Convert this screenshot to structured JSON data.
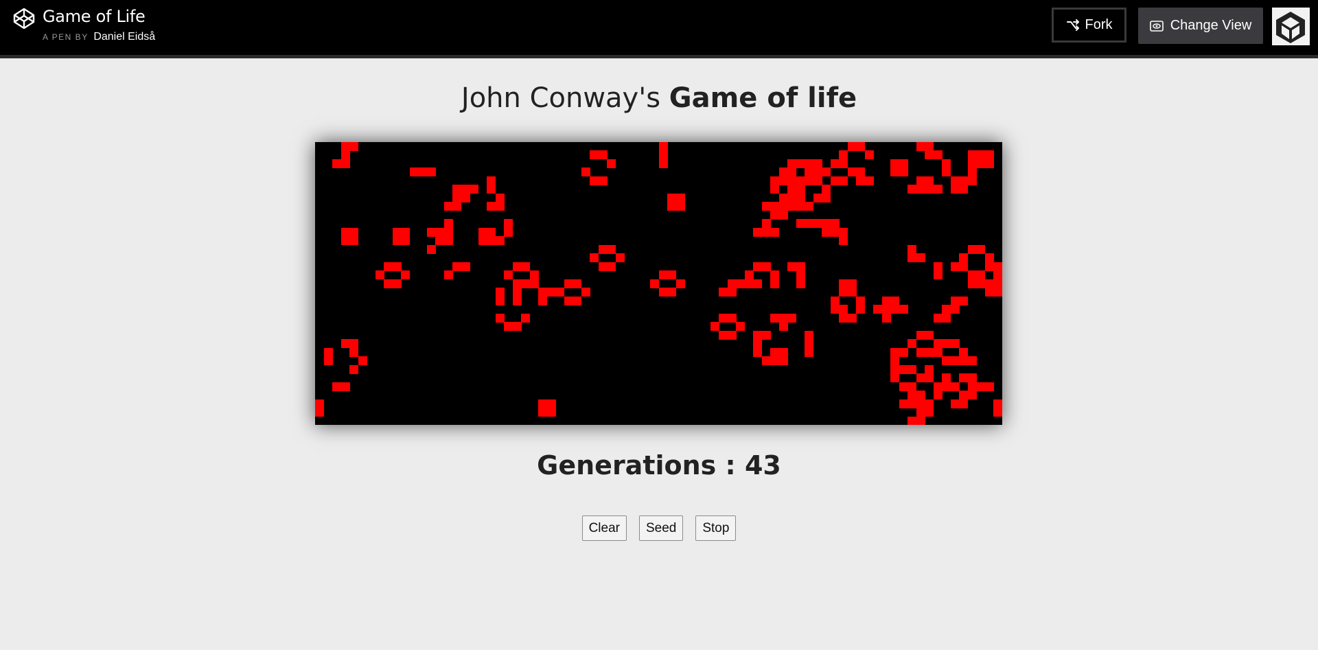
{
  "header": {
    "pen_title": "Game of Life",
    "byline_prefix": "A PEN BY",
    "author": "Daniel Eidså",
    "fork_label": "Fork",
    "change_view_label": "Change View",
    "icons": {
      "logo": "codepen-logo-icon",
      "fork": "fork-icon",
      "view": "eye-icon",
      "avatar": "user-avatar"
    }
  },
  "main": {
    "title_prefix": "John Conway's ",
    "title_bold": "Game of life",
    "generations_text": "Generations : 43",
    "buttons": {
      "clear": "Clear",
      "seed": "Seed",
      "stop": "Stop"
    }
  },
  "board": {
    "columns": 80,
    "rows": 33,
    "alive_color": "#ff0000",
    "dead_color": "#000000",
    "alive_cells": [
      [
        3,
        0
      ],
      [
        4,
        0
      ],
      [
        3,
        1
      ],
      [
        2,
        2
      ],
      [
        3,
        2
      ],
      [
        0,
        30
      ],
      [
        0,
        31
      ],
      [
        11,
        3
      ],
      [
        12,
        3
      ],
      [
        13,
        3
      ],
      [
        16,
        5
      ],
      [
        17,
        5
      ],
      [
        18,
        5
      ],
      [
        16,
        6
      ],
      [
        17,
        6
      ],
      [
        15,
        7
      ],
      [
        16,
        7
      ],
      [
        20,
        4
      ],
      [
        20,
        5
      ],
      [
        21,
        6
      ],
      [
        20,
        7
      ],
      [
        21,
        7
      ],
      [
        3,
        10
      ],
      [
        4,
        10
      ],
      [
        3,
        11
      ],
      [
        4,
        11
      ],
      [
        9,
        10
      ],
      [
        10,
        10
      ],
      [
        9,
        11
      ],
      [
        10,
        11
      ],
      [
        13,
        10
      ],
      [
        14,
        10
      ],
      [
        15,
        10
      ],
      [
        15,
        9
      ],
      [
        14,
        11
      ],
      [
        15,
        11
      ],
      [
        13,
        12
      ],
      [
        19,
        10
      ],
      [
        20,
        10
      ],
      [
        19,
        11
      ],
      [
        20,
        11
      ],
      [
        22,
        9
      ],
      [
        22,
        10
      ],
      [
        21,
        11
      ],
      [
        16,
        14
      ],
      [
        17,
        14
      ],
      [
        15,
        15
      ],
      [
        8,
        14
      ],
      [
        9,
        14
      ],
      [
        7,
        15
      ],
      [
        10,
        15
      ],
      [
        8,
        16
      ],
      [
        9,
        16
      ],
      [
        23,
        14
      ],
      [
        24,
        14
      ],
      [
        22,
        15
      ],
      [
        25,
        15
      ],
      [
        23,
        16
      ],
      [
        24,
        16
      ],
      [
        25,
        16
      ],
      [
        21,
        17
      ],
      [
        21,
        18
      ],
      [
        23,
        17
      ],
      [
        24,
        16
      ],
      [
        23,
        18
      ],
      [
        21,
        20
      ],
      [
        22,
        21
      ],
      [
        23,
        21
      ],
      [
        24,
        20
      ],
      [
        26,
        17
      ],
      [
        27,
        17
      ],
      [
        29,
        16
      ],
      [
        30,
        16
      ],
      [
        28,
        17
      ],
      [
        31,
        17
      ],
      [
        26,
        18
      ],
      [
        29,
        18
      ],
      [
        30,
        18
      ],
      [
        33,
        12
      ],
      [
        34,
        12
      ],
      [
        32,
        13
      ],
      [
        35,
        13
      ],
      [
        33,
        14
      ],
      [
        34,
        14
      ],
      [
        40,
        0
      ],
      [
        40,
        1
      ],
      [
        40,
        2
      ],
      [
        41,
        6
      ],
      [
        42,
        6
      ],
      [
        41,
        7
      ],
      [
        42,
        7
      ],
      [
        32,
        1
      ],
      [
        33,
        1
      ],
      [
        34,
        2
      ],
      [
        31,
        3
      ],
      [
        32,
        4
      ],
      [
        33,
        4
      ],
      [
        40,
        15
      ],
      [
        41,
        15
      ],
      [
        39,
        16
      ],
      [
        42,
        16
      ],
      [
        40,
        17
      ],
      [
        41,
        17
      ],
      [
        3,
        23
      ],
      [
        4,
        23
      ],
      [
        1,
        24
      ],
      [
        4,
        24
      ],
      [
        1,
        25
      ],
      [
        5,
        25
      ],
      [
        4,
        26
      ],
      [
        2,
        28
      ],
      [
        3,
        28
      ],
      [
        26,
        30
      ],
      [
        27,
        30
      ],
      [
        26,
        31
      ],
      [
        27,
        31
      ],
      [
        62,
        0
      ],
      [
        63,
        0
      ],
      [
        61,
        1
      ],
      [
        64,
        1
      ],
      [
        60,
        2
      ],
      [
        61,
        2
      ],
      [
        62,
        3
      ],
      [
        63,
        3
      ],
      [
        60,
        4
      ],
      [
        61,
        4
      ],
      [
        63,
        4
      ],
      [
        64,
        4
      ],
      [
        57,
        2
      ],
      [
        58,
        2
      ],
      [
        57,
        3
      ],
      [
        58,
        3
      ],
      [
        59,
        3
      ],
      [
        56,
        4
      ],
      [
        58,
        4
      ],
      [
        56,
        5
      ],
      [
        59,
        5
      ],
      [
        58,
        6
      ],
      [
        59,
        6
      ],
      [
        56,
        7
      ],
      [
        57,
        7
      ],
      [
        55,
        2
      ],
      [
        56,
        2
      ],
      [
        54,
        3
      ],
      [
        55,
        3
      ],
      [
        53,
        4
      ],
      [
        54,
        4
      ],
      [
        55,
        4
      ],
      [
        57,
        4
      ],
      [
        55,
        5
      ],
      [
        55,
        6
      ],
      [
        56,
        6
      ],
      [
        54,
        7
      ],
      [
        55,
        7
      ],
      [
        53,
        5
      ],
      [
        54,
        6
      ],
      [
        52,
        7
      ],
      [
        53,
        7
      ],
      [
        53,
        8
      ],
      [
        54,
        8
      ],
      [
        52,
        9
      ],
      [
        51,
        10
      ],
      [
        52,
        10
      ],
      [
        53,
        10
      ],
      [
        56,
        9
      ],
      [
        57,
        9
      ],
      [
        58,
        9
      ],
      [
        59,
        9
      ],
      [
        60,
        9
      ],
      [
        59,
        10
      ],
      [
        60,
        10
      ],
      [
        61,
        10
      ],
      [
        61,
        11
      ],
      [
        67,
        2
      ],
      [
        68,
        2
      ],
      [
        67,
        3
      ],
      [
        68,
        3
      ],
      [
        70,
        4
      ],
      [
        71,
        4
      ],
      [
        69,
        5
      ],
      [
        70,
        5
      ],
      [
        71,
        5
      ],
      [
        72,
        5
      ],
      [
        70,
        0
      ],
      [
        71,
        0
      ],
      [
        71,
        1
      ],
      [
        72,
        1
      ],
      [
        73,
        2
      ],
      [
        73,
        3
      ],
      [
        74,
        4
      ],
      [
        75,
        4
      ],
      [
        74,
        5
      ],
      [
        75,
        5
      ],
      [
        76,
        1
      ],
      [
        77,
        1
      ],
      [
        78,
        1
      ],
      [
        76,
        2
      ],
      [
        77,
        2
      ],
      [
        78,
        2
      ],
      [
        76,
        3
      ],
      [
        76,
        4
      ],
      [
        51,
        14
      ],
      [
        52,
        14
      ],
      [
        50,
        15
      ],
      [
        53,
        15
      ],
      [
        50,
        16
      ],
      [
        51,
        16
      ],
      [
        53,
        16
      ],
      [
        55,
        14
      ],
      [
        56,
        14
      ],
      [
        56,
        15
      ],
      [
        56,
        16
      ],
      [
        48,
        16
      ],
      [
        49,
        16
      ],
      [
        47,
        17
      ],
      [
        48,
        17
      ],
      [
        61,
        16
      ],
      [
        62,
        16
      ],
      [
        61,
        17
      ],
      [
        62,
        17
      ],
      [
        60,
        18
      ],
      [
        63,
        18
      ],
      [
        60,
        19
      ],
      [
        61,
        19
      ],
      [
        63,
        19
      ],
      [
        61,
        20
      ],
      [
        62,
        20
      ],
      [
        66,
        18
      ],
      [
        67,
        18
      ],
      [
        65,
        19
      ],
      [
        66,
        19
      ],
      [
        67,
        19
      ],
      [
        68,
        19
      ],
      [
        66,
        20
      ],
      [
        69,
        12
      ],
      [
        69,
        13
      ],
      [
        70,
        13
      ],
      [
        72,
        14
      ],
      [
        72,
        15
      ],
      [
        76,
        12
      ],
      [
        77,
        12
      ],
      [
        75,
        13
      ],
      [
        78,
        13
      ],
      [
        74,
        14
      ],
      [
        75,
        14
      ],
      [
        78,
        14
      ],
      [
        79,
        14
      ],
      [
        76,
        15
      ],
      [
        77,
        15
      ],
      [
        79,
        15
      ],
      [
        76,
        16
      ],
      [
        77,
        16
      ],
      [
        78,
        16
      ],
      [
        79,
        16
      ],
      [
        78,
        17
      ],
      [
        79,
        17
      ],
      [
        74,
        18
      ],
      [
        75,
        18
      ],
      [
        73,
        19
      ],
      [
        74,
        19
      ],
      [
        72,
        20
      ],
      [
        73,
        20
      ],
      [
        47,
        20
      ],
      [
        48,
        20
      ],
      [
        46,
        21
      ],
      [
        49,
        21
      ],
      [
        47,
        22
      ],
      [
        48,
        22
      ],
      [
        51,
        22
      ],
      [
        52,
        22
      ],
      [
        51,
        23
      ],
      [
        51,
        24
      ],
      [
        53,
        24
      ],
      [
        54,
        24
      ],
      [
        52,
        25
      ],
      [
        53,
        25
      ],
      [
        54,
        25
      ],
      [
        57,
        22
      ],
      [
        57,
        23
      ],
      [
        57,
        24
      ],
      [
        53,
        20
      ],
      [
        54,
        20
      ],
      [
        55,
        20
      ],
      [
        54,
        21
      ],
      [
        70,
        22
      ],
      [
        71,
        22
      ],
      [
        69,
        23
      ],
      [
        72,
        23
      ],
      [
        67,
        24
      ],
      [
        68,
        24
      ],
      [
        70,
        24
      ],
      [
        71,
        24
      ],
      [
        73,
        23
      ],
      [
        74,
        23
      ],
      [
        72,
        24
      ],
      [
        75,
        24
      ],
      [
        73,
        25
      ],
      [
        74,
        25
      ],
      [
        75,
        25
      ],
      [
        76,
        25
      ],
      [
        67,
        25
      ],
      [
        67,
        26
      ],
      [
        68,
        26
      ],
      [
        69,
        26
      ],
      [
        71,
        26
      ],
      [
        67,
        27
      ],
      [
        70,
        27
      ],
      [
        71,
        27
      ],
      [
        73,
        27
      ],
      [
        75,
        27
      ],
      [
        76,
        27
      ],
      [
        68,
        28
      ],
      [
        69,
        28
      ],
      [
        72,
        28
      ],
      [
        73,
        28
      ],
      [
        74,
        28
      ],
      [
        76,
        28
      ],
      [
        77,
        28
      ],
      [
        78,
        28
      ],
      [
        69,
        29
      ],
      [
        70,
        29
      ],
      [
        72,
        29
      ],
      [
        75,
        29
      ],
      [
        76,
        29
      ],
      [
        68,
        30
      ],
      [
        69,
        30
      ],
      [
        70,
        30
      ],
      [
        71,
        30
      ],
      [
        74,
        30
      ],
      [
        75,
        30
      ],
      [
        79,
        30
      ],
      [
        70,
        31
      ],
      [
        71,
        31
      ],
      [
        79,
        31
      ],
      [
        69,
        32
      ],
      [
        70,
        32
      ]
    ]
  }
}
